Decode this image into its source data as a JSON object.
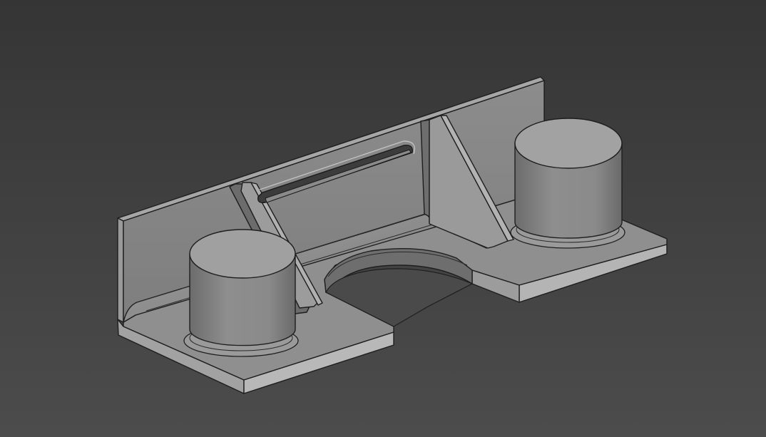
{
  "viewer": {
    "background_top": "#353535",
    "background_bottom": "#4c4c4c",
    "model_color": "#8a8a8a"
  }
}
